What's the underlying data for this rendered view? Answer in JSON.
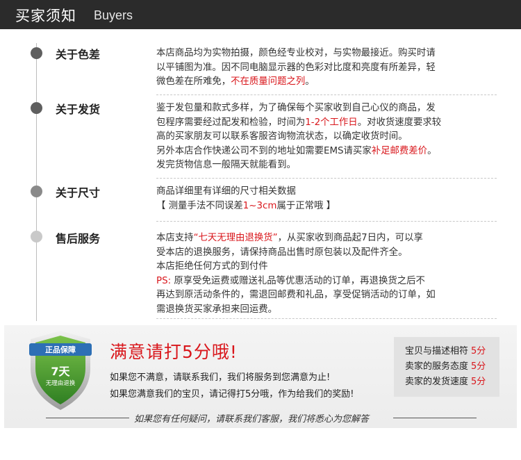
{
  "header": {
    "title_cn": "买家须知",
    "title_en": "Buyers"
  },
  "sections": [
    {
      "title": "关于色差",
      "lines": [
        [
          {
            "t": "本店商品均为实物拍摄，颜色经专业校对，与实物最接近。购买时请"
          }
        ],
        [
          {
            "t": "以平铺图为准。因不同电脑显示器的色彩对比度和亮度有所差异，轻"
          }
        ],
        [
          {
            "t": "微色差在所难免，"
          },
          {
            "t": "不在质量问题之列",
            "red": true
          },
          {
            "t": "。"
          }
        ]
      ]
    },
    {
      "title": "关于发货",
      "lines": [
        [
          {
            "t": "鉴于发包量和款式多样，为了确保每个买家收到自己心仪的商品，发"
          }
        ],
        [
          {
            "t": "包程序需要经过配发和检验，时间为"
          },
          {
            "t": "1-2个工作日",
            "red": true
          },
          {
            "t": "。对收货速度要求较"
          }
        ],
        [
          {
            "t": "高的买家朋友可以联系客服咨询物流状态，以确定收货时间。"
          }
        ],
        [
          {
            "t": "另外本店合作快递公司不到的地址如需要EMS请买家"
          },
          {
            "t": "补足邮费差价",
            "red": true
          },
          {
            "t": "。"
          }
        ],
        [
          {
            "t": "发完货物信息一般隔天就能看到。"
          }
        ]
      ]
    },
    {
      "title": "关于尺寸",
      "lines": [
        [
          {
            "t": "商品详细里有详细的尺寸相关数据"
          }
        ],
        [
          {
            "t": "【 测量手法不同误差"
          },
          {
            "t": "1~3cm",
            "red": true
          },
          {
            "t": "属于正常哦 】"
          }
        ]
      ]
    },
    {
      "title": "售后服务",
      "lines": [
        [
          {
            "t": "本店支持"
          },
          {
            "t": "“七天无理由退换货”",
            "red": true
          },
          {
            "t": "，从买家收到商品起7日内，可以享"
          }
        ],
        [
          {
            "t": "受本店的退换服务，请保持商品出售时原包装以及配件齐全。"
          }
        ],
        [
          {
            "t": "本店拒绝任何方式的到付件"
          }
        ],
        [
          {
            "t": "PS:",
            "red": true
          },
          {
            "t": " 原享受免运费或赠送礼品等优惠活动的订单，再退换货之后不"
          }
        ],
        [
          {
            "t": "再达到原活动条件的，需退回邮费和礼品，享受促销活动的订单，如"
          }
        ],
        [
          {
            "t": "需退换货买家承担来回运费。"
          }
        ]
      ]
    }
  ],
  "badge": {
    "top_label": "正品保障",
    "days": "7天",
    "sub_label": "无理由退换"
  },
  "panel": {
    "title": "满意请打5分哦!",
    "line1": "如果您不满意，请联系我们，我们将服务到您满意为止!",
    "line2": "如果您满意我们的宝贝，请记得打5分哦，作为给我们的奖励!"
  },
  "ratings": [
    {
      "label": "宝贝与描述相符",
      "score": "5分"
    },
    {
      "label": "卖家的服务态度",
      "score": "5分"
    },
    {
      "label": "卖家的发货速度",
      "score": "5分"
    }
  ],
  "footer": {
    "text": "如果您有任何疑问，请联系我们客服，我们将悉心为您解答"
  },
  "colors": {
    "accent_red": "#d9171c",
    "header_bg": "#2b2b2b",
    "badge_green": "#3f9a2f"
  }
}
